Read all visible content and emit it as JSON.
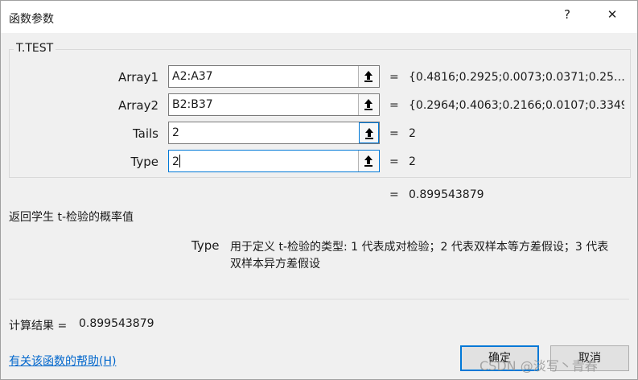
{
  "title_bar": {
    "title": "函数参数",
    "help_glyph": "?",
    "close_glyph": "✕"
  },
  "function_name": "T.TEST",
  "arguments": [
    {
      "label": "Array1",
      "value": "A2:A37",
      "equals": "=",
      "result": "{0.4816;0.2925;0.0073;0.0371;0.25…"
    },
    {
      "label": "Array2",
      "value": "B2:B37",
      "equals": "=",
      "result": "{0.2964;0.4063;0.2166;0.0107;0.3349"
    },
    {
      "label": "Tails",
      "value": "2",
      "equals": "=",
      "result": "2"
    },
    {
      "label": "Type",
      "value": "2",
      "equals": "=",
      "result": "2"
    }
  ],
  "overall_result": {
    "equals": "=",
    "value": "0.899543879"
  },
  "function_description": "返回学生 t-检验的概率值",
  "argument_help": {
    "name": "Type",
    "line1": "用于定义 t-检验的类型: 1 代表成对检验；2 代表双样本等方差假设；3 代表",
    "line2": "双样本异方差假设"
  },
  "calc_result": {
    "label": "计算结果 =",
    "value": "0.899543879"
  },
  "help_link": "有关该函数的帮助(H)",
  "buttons": {
    "ok": "确定",
    "cancel": "取消"
  },
  "watermark": "CSDN @淡写丶青春",
  "icons": {
    "collapse": "collapse-dialog-arrow-icon"
  }
}
